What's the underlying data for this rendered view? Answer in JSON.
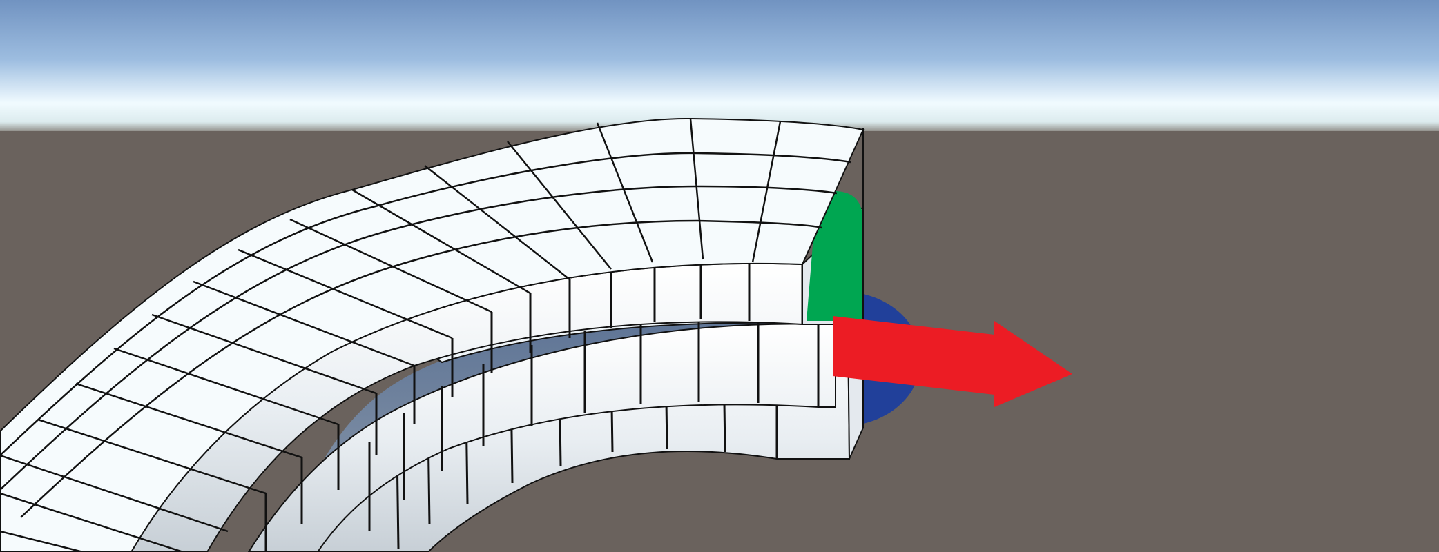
{
  "scene": {
    "sky_top_color": "#7596c2",
    "sky_horizon_color": "#f2fbff",
    "ground_color": "#6a625d",
    "mesh_face_color": "#f3f7fa",
    "mesh_side_color": "#e2e7ec",
    "mesh_underside_color": "#7c8da1",
    "mesh_line_color": "#111111",
    "objects": [
      "curved-grid-mesh",
      "transform-gizmo"
    ]
  },
  "gizmo": {
    "x_axis_color": "#ec1c24",
    "y_axis_color": "#00a651",
    "z_axis_color": "#21409a",
    "icons": [
      "x-axis-arrow-icon",
      "y-axis-handle-icon",
      "z-axis-disc-icon"
    ]
  }
}
